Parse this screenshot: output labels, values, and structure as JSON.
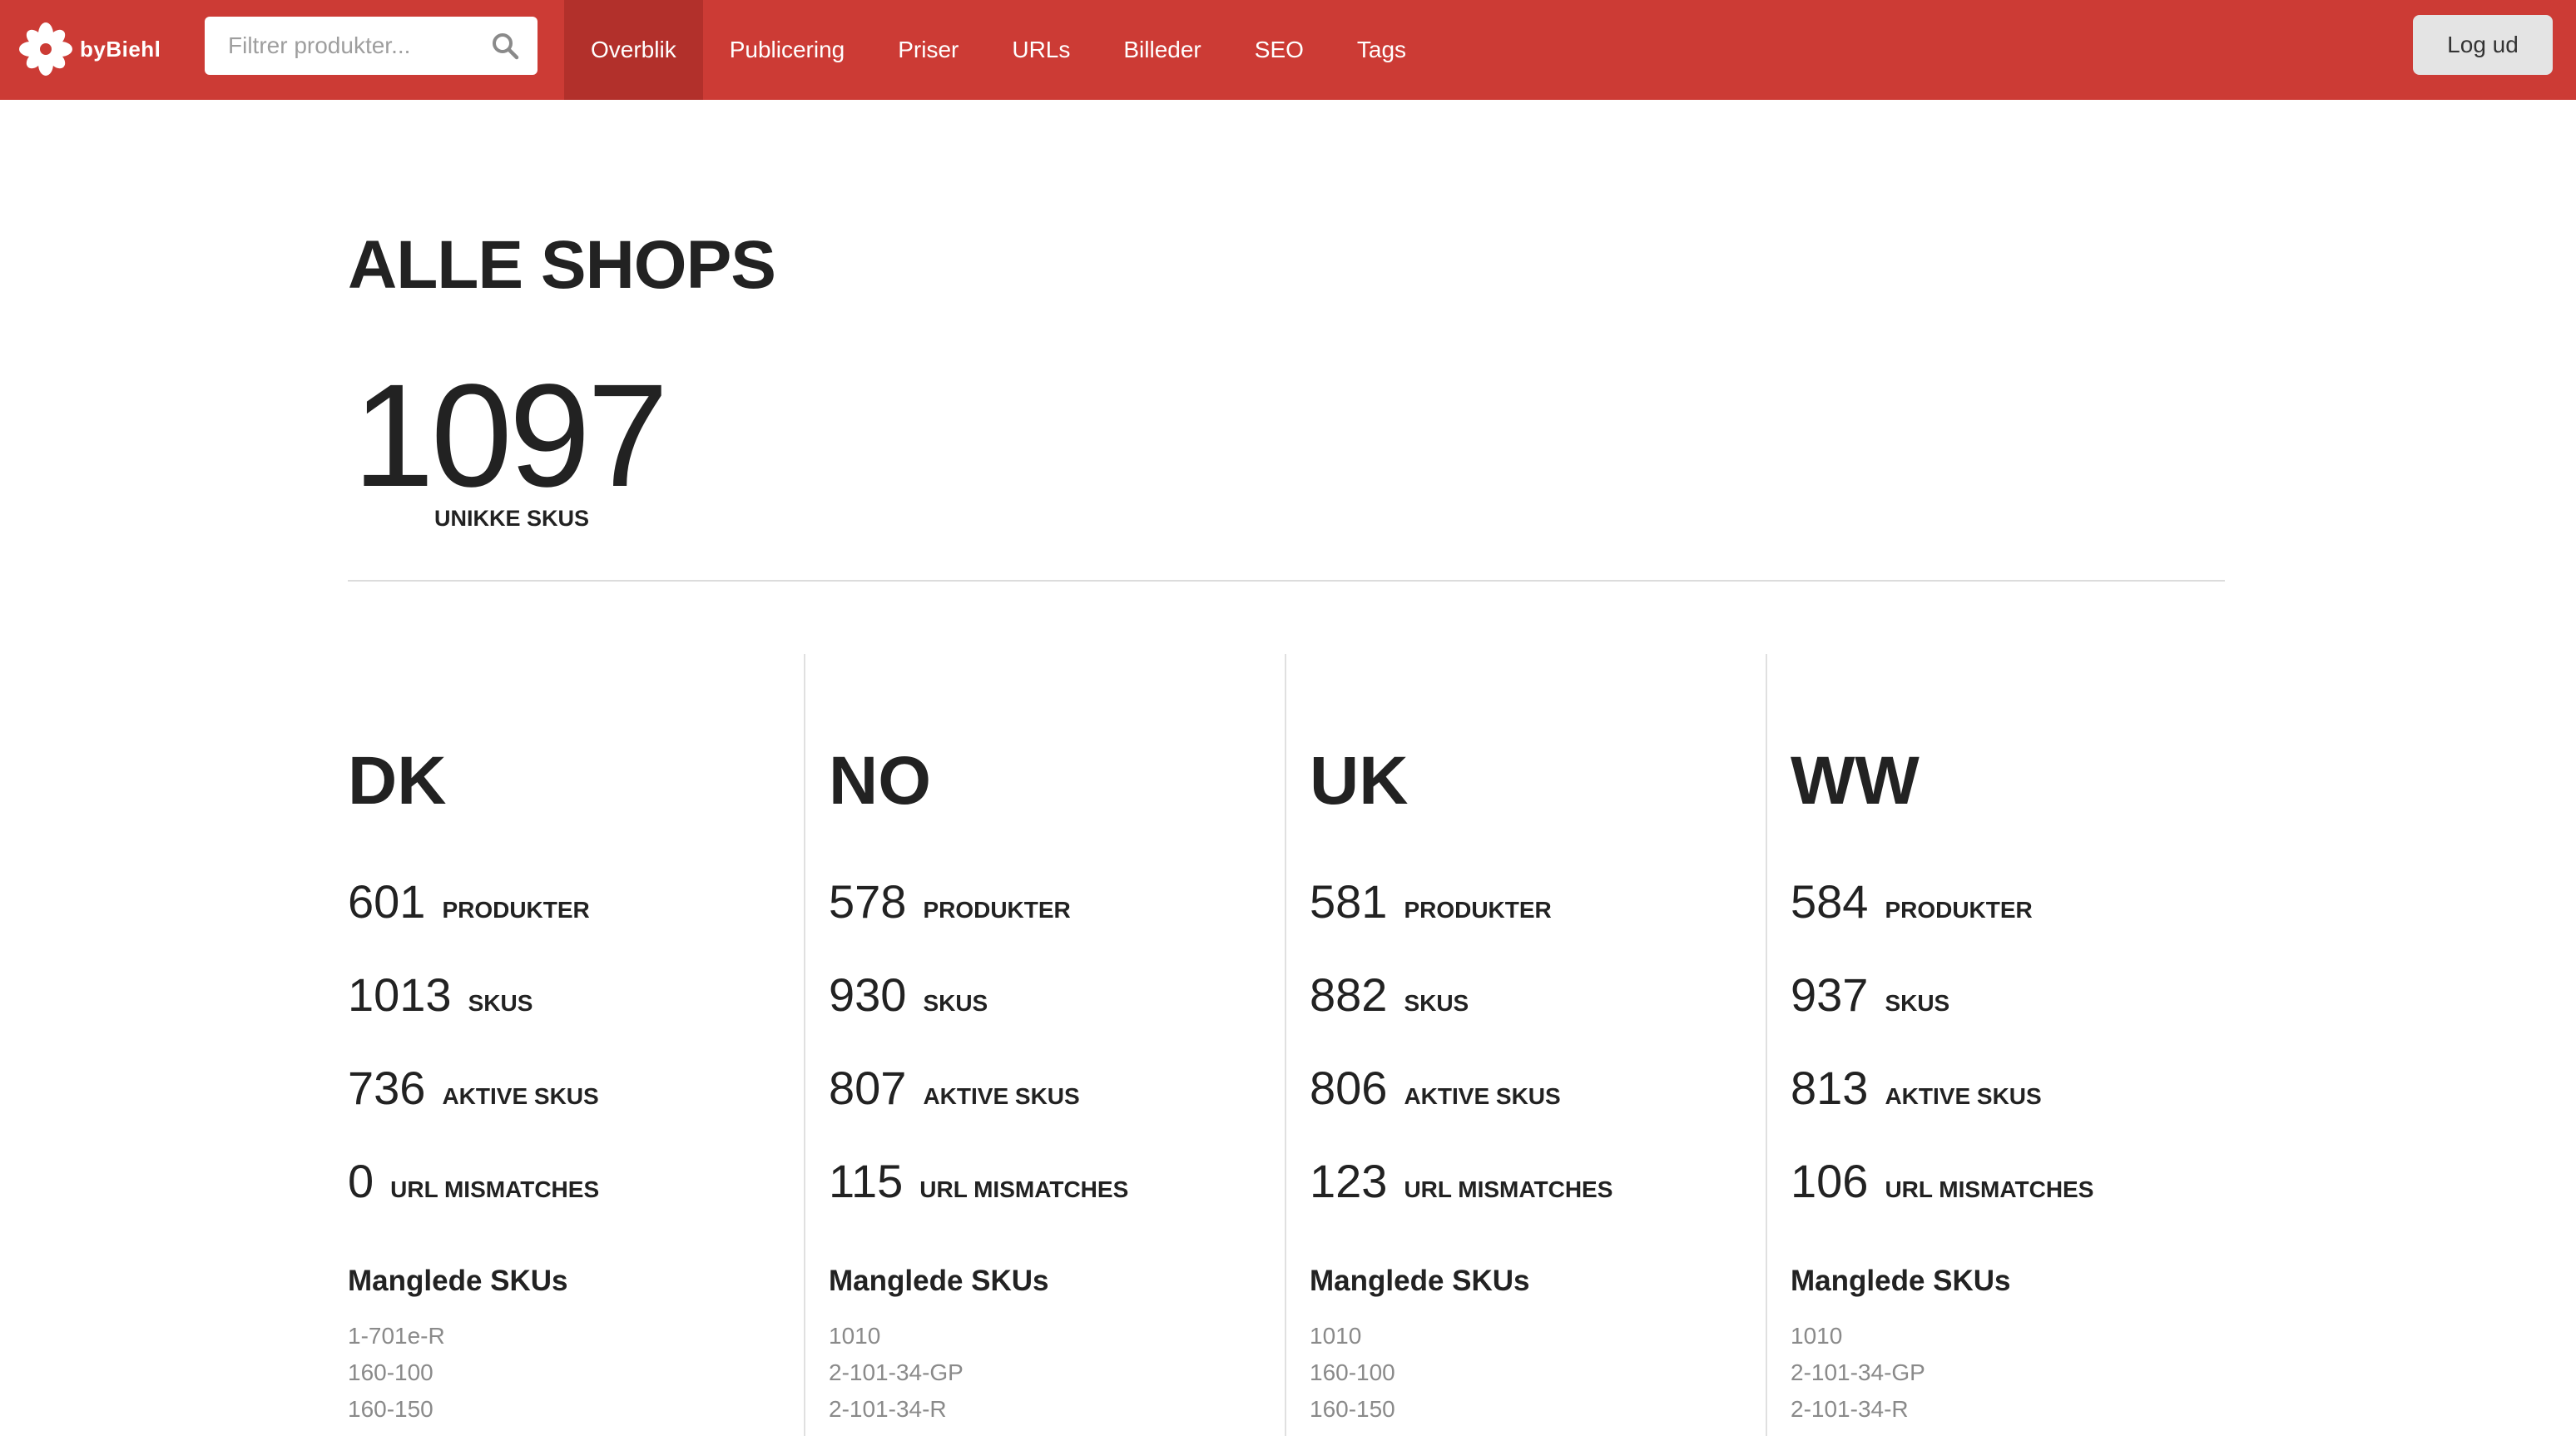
{
  "header": {
    "logo_text": "byBiehl",
    "search_placeholder": "Filtrer produkter...",
    "nav": [
      {
        "label": "Overblik",
        "active": true
      },
      {
        "label": "Publicering"
      },
      {
        "label": "Priser"
      },
      {
        "label": "URLs"
      },
      {
        "label": "Billeder"
      },
      {
        "label": "SEO"
      },
      {
        "label": "Tags"
      }
    ],
    "logout_label": "Log ud"
  },
  "summary": {
    "title": "ALLE SHOPS",
    "unique_skus": "1097",
    "unique_skus_label": "UNIKKE SKUS"
  },
  "stat_labels": {
    "products": "PRODUKTER",
    "skus": "SKUS",
    "active_skus": "AKTIVE SKUS",
    "url_mismatches": "URL MISMATCHES"
  },
  "missing_title": "Manglede SKUs",
  "shops": [
    {
      "code": "DK",
      "products": "601",
      "skus": "1013",
      "active_skus": "736",
      "url_mismatches": "0",
      "missing": [
        "1-701e-R",
        "160-100",
        "160-150"
      ]
    },
    {
      "code": "NO",
      "products": "578",
      "skus": "930",
      "active_skus": "807",
      "url_mismatches": "115",
      "missing": [
        "1010",
        "2-101-34-GP",
        "2-101-34-R"
      ]
    },
    {
      "code": "UK",
      "products": "581",
      "skus": "882",
      "active_skus": "806",
      "url_mismatches": "123",
      "missing": [
        "1010",
        "160-100",
        "160-150"
      ]
    },
    {
      "code": "WW",
      "products": "584",
      "skus": "937",
      "active_skus": "813",
      "url_mismatches": "106",
      "missing": [
        "1010",
        "2-101-34-GP",
        "2-101-34-R"
      ]
    }
  ],
  "colors": {
    "brand_red": "#cc3b35",
    "nav_active": "#b2302b"
  }
}
